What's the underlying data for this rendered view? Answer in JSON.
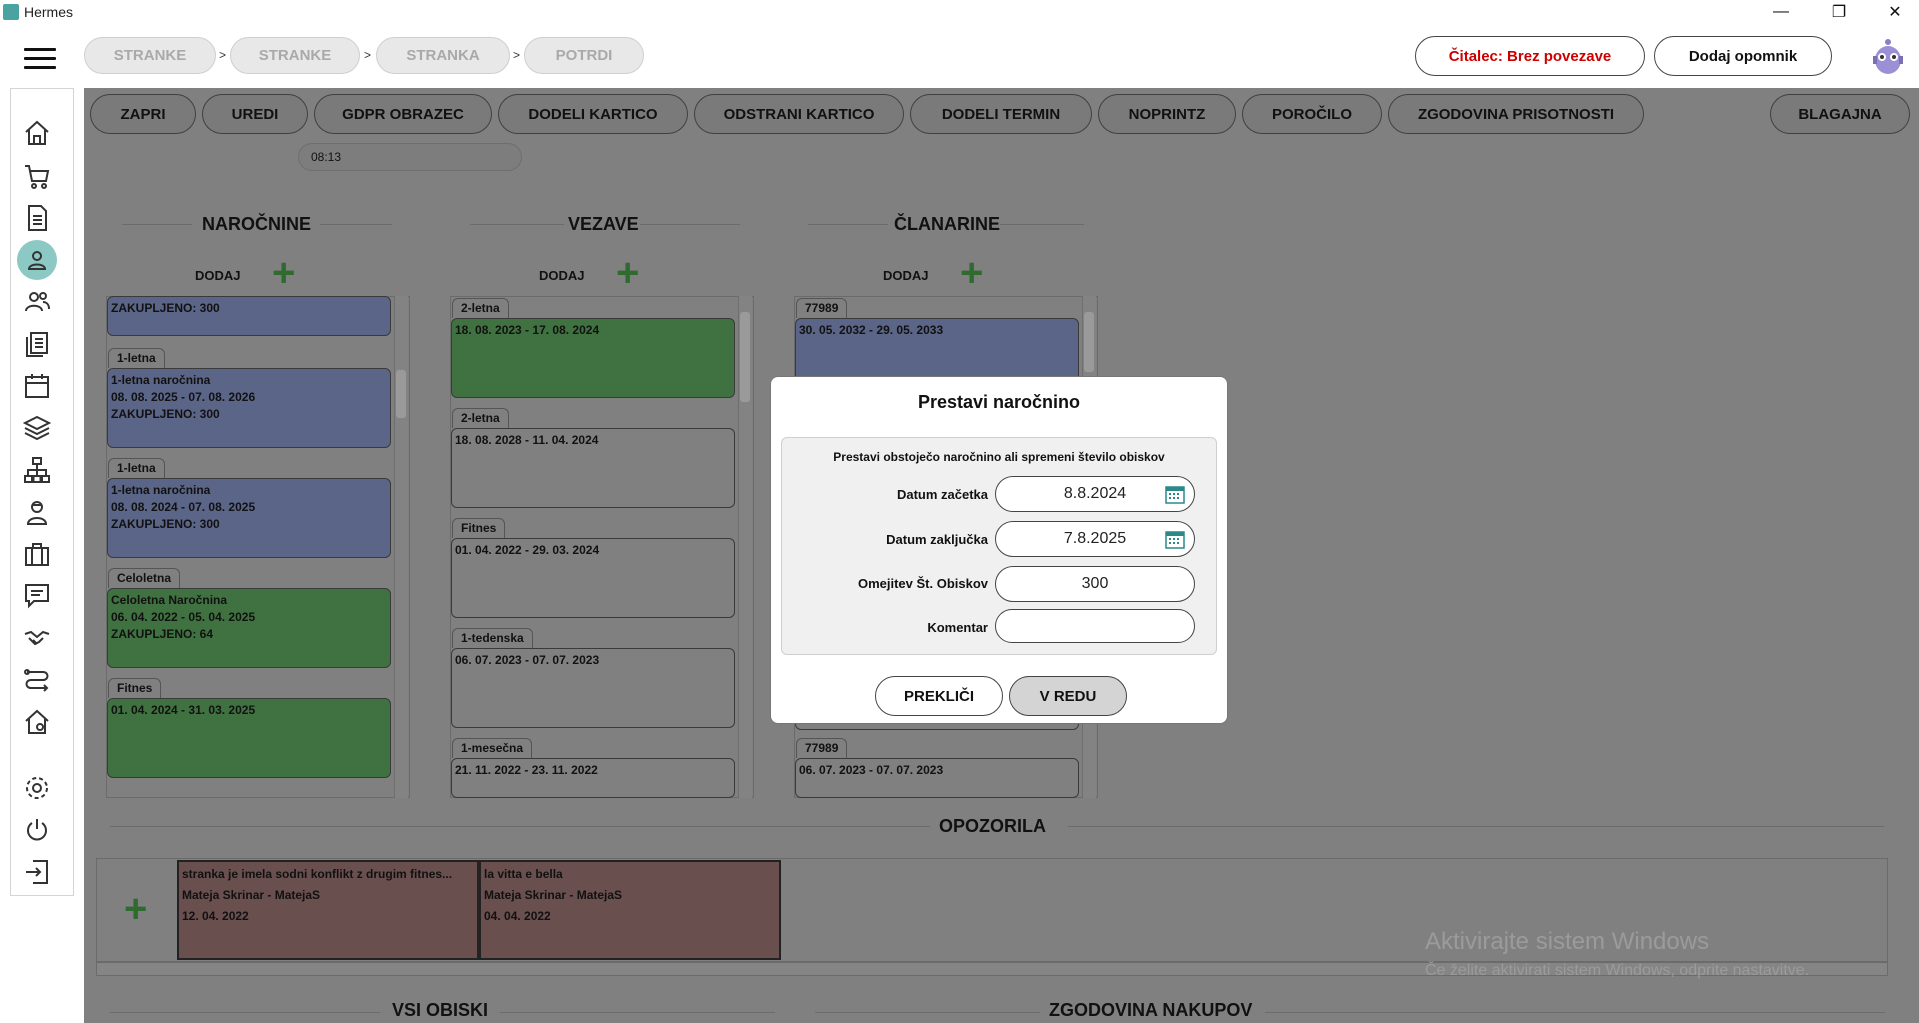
{
  "window": {
    "title": "Hermes",
    "minimize": "—",
    "maximize": "❐",
    "close": "✕"
  },
  "breadcrumbs": [
    "STRANKE",
    "STRANKE",
    "STRANKA",
    "POTRDI"
  ],
  "breadcrumb_sep": ">",
  "header": {
    "reader_status": "Čitalec: Brez povezave",
    "add_reminder": "Dodaj opomnik",
    "reader_status_color": "#cc0000"
  },
  "toolbar": [
    "ZAPRI",
    "UREDI",
    "GDPR OBRAZEC",
    "DODELI KARTICO",
    "ODSTRANI KARTICO",
    "DODELI TERMIN",
    "NOPRINTZ",
    "POROČILO",
    "ZGODOVINA PRISOTNOSTI",
    "BLAGAJNA"
  ],
  "time": "08:13",
  "sections": {
    "narocnine": "NAROČNINE",
    "vezave": "VEZAVE",
    "clanarine": "ČLANARINE",
    "add": "DODAJ"
  },
  "narocnine_cards": {
    "top_partial": "ZAKUPLJENO: 300",
    "c1": {
      "tag": "1-letna",
      "l1": "1-letna naročnina",
      "l2": "08. 08. 2025 - 07. 08. 2026",
      "l3": "ZAKUPLJENO: 300"
    },
    "c2": {
      "tag": "1-letna",
      "l1": "1-letna naročnina",
      "l2": "08. 08. 2024 - 07. 08. 2025",
      "l3": "ZAKUPLJENO: 300"
    },
    "c3": {
      "tag": "Celoletna",
      "l1": "Celoletna Naročnina",
      "l2": "06. 04. 2022 - 05. 04. 2025",
      "l3": "ZAKUPLJENO: 64"
    },
    "c4": {
      "tag": "Fitnes",
      "l1": "01. 04. 2024 - 31. 03. 2025"
    }
  },
  "vezave_cards": {
    "c1": {
      "tag": "2-letna",
      "l1": "18. 08. 2023 - 17. 08. 2024"
    },
    "c2": {
      "tag": "2-letna",
      "l1": "18. 08. 2028 - 11. 04. 2024"
    },
    "c3": {
      "tag": "Fitnes",
      "l1": "01. 04. 2022 - 29. 03. 2024"
    },
    "c4": {
      "tag": "1-tedenska",
      "l1": "06. 07. 2023 - 07. 07. 2023"
    },
    "c5": {
      "tag": "1-mesečna",
      "l1": "21. 11. 2022 - 23. 11. 2022"
    }
  },
  "clanarine_cards": {
    "c1": {
      "tag": "77989",
      "l1": "30. 05. 2032 - 29. 05. 2033"
    },
    "c2": {
      "tag": "77989",
      "l1": "06. 07. 2023 - 07. 07. 2023"
    }
  },
  "warnings_title": "OPOZORILA",
  "warnings": [
    {
      "text": "stranka je imela sodni konflikt z drugim fitnes...",
      "author": "Mateja Skrinar - MatejaS",
      "date": "12. 04. 2022"
    },
    {
      "text": "la vitta e bella",
      "author": "Mateja Skrinar - MatejaS",
      "date": "04. 04. 2022"
    }
  ],
  "bottom": {
    "visits": "VSI OBISKI",
    "history": "ZGODOVINA NAKUPOV"
  },
  "watermark": {
    "line1": "Aktivirajte sistem Windows",
    "line2": "Če želite aktivirati sistem Windows, odprite nastavitve."
  },
  "modal": {
    "title": "Prestavi naročnino",
    "description": "Prestavi obstoječo naročnino ali spremeni število obiskov",
    "start_label": "Datum začetka",
    "start_value": "8.8.2024",
    "end_label": "Datum zaključka",
    "end_value": "7.8.2025",
    "visits_label": "Omejitev Št. Obiskov",
    "visits_value": "300",
    "comment_label": "Komentar",
    "comment_value": "",
    "cancel": "PREKLIČI",
    "ok": "V REDU"
  },
  "icons": [
    "home-icon",
    "cart-icon",
    "document-icon",
    "person-icon",
    "people-icon",
    "list-icon",
    "calendar-icon",
    "layers-icon",
    "hierarchy-icon",
    "trainer-icon",
    "briefcase-icon",
    "chat-icon",
    "handshake-icon",
    "route-icon",
    "house-icon",
    "settings-icon",
    "power-icon",
    "logout-icon"
  ],
  "colors": {
    "accent": "#8cc9c5",
    "overlay": "#808080",
    "plus": "#2f6b2f"
  }
}
